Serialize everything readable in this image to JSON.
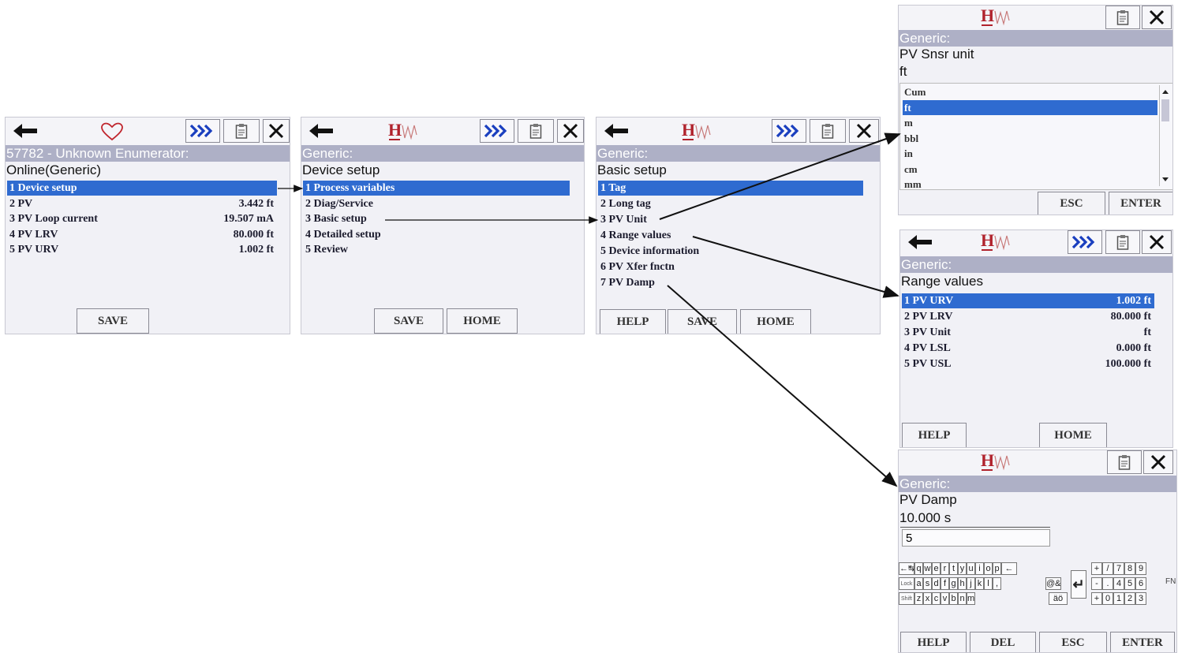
{
  "screens": {
    "online": {
      "header": "57782 - Unknown Enumerator:",
      "subheader": "Online(Generic)",
      "items": [
        {
          "label": "1 Device setup",
          "value": ""
        },
        {
          "label": "2 PV",
          "value": "3.442 ft"
        },
        {
          "label": "3 PV Loop current",
          "value": "19.507 mA"
        },
        {
          "label": "4 PV LRV",
          "value": "80.000 ft"
        },
        {
          "label": "5 PV URV",
          "value": "1.002 ft"
        }
      ],
      "selected_index": 0,
      "buttons": {
        "save": "SAVE"
      }
    },
    "device_setup": {
      "header": "Generic:",
      "subheader": "Device setup",
      "items": [
        {
          "label": "1 Process variables"
        },
        {
          "label": "2 Diag/Service"
        },
        {
          "label": "3 Basic setup"
        },
        {
          "label": "4 Detailed setup"
        },
        {
          "label": "5 Review"
        }
      ],
      "selected_index": 0,
      "buttons": {
        "save": "SAVE",
        "home": "HOME"
      }
    },
    "basic_setup": {
      "header": "Generic:",
      "subheader": "Basic setup",
      "items": [
        {
          "label": "1 Tag"
        },
        {
          "label": "2 Long tag"
        },
        {
          "label": "3 PV Unit"
        },
        {
          "label": "4 Range values"
        },
        {
          "label": "5 Device information"
        },
        {
          "label": "6 PV Xfer fnctn"
        },
        {
          "label": "7 PV Damp"
        }
      ],
      "selected_index": 0,
      "buttons": {
        "help": "HELP",
        "save": "SAVE",
        "home": "HOME"
      }
    },
    "pv_unit": {
      "header": "Generic:",
      "title": "PV Snsr unit",
      "current": "ft",
      "options": [
        "Cum",
        "ft",
        "m",
        "bbl",
        "in",
        "cm",
        "mm"
      ],
      "selected_option": "ft",
      "buttons": {
        "esc": "ESC",
        "enter": "ENTER"
      }
    },
    "range_values": {
      "header": "Generic:",
      "subheader": "Range values",
      "items": [
        {
          "label": "1 PV URV",
          "value": "1.002 ft"
        },
        {
          "label": "2 PV LRV",
          "value": "80.000 ft"
        },
        {
          "label": "3 PV Unit",
          "value": "ft"
        },
        {
          "label": "4 PV LSL",
          "value": "0.000 ft"
        },
        {
          "label": "5 PV USL",
          "value": "100.000 ft"
        }
      ],
      "selected_index": 0,
      "buttons": {
        "help": "HELP",
        "home": "HOME"
      }
    },
    "pv_damp": {
      "header": "Generic:",
      "title": "PV Damp",
      "current": "10.000 s",
      "input_value": "5",
      "keyboard": {
        "row1": [
          "←↹",
          "q",
          "w",
          "e",
          "r",
          "t",
          "y",
          "u",
          "i",
          "o",
          "p",
          "←"
        ],
        "row2": [
          "Lock",
          "a",
          "s",
          "d",
          "f",
          "g",
          "h",
          "j",
          "k",
          "l",
          ","
        ],
        "row3": [
          "Shift",
          "z",
          "x",
          "c",
          "v",
          "b",
          "n",
          "m"
        ],
        "special": {
          "enter_glyph": "↵",
          "at_key": "@&",
          "accent_key": "äö",
          "fn": "FN"
        },
        "num1": [
          "+",
          "/",
          "7",
          "8",
          "9"
        ],
        "num2": [
          "-",
          ".",
          "4",
          "5",
          "6"
        ],
        "num3": [
          "+",
          "0",
          "1",
          "2",
          "3"
        ]
      },
      "buttons": {
        "help": "HELP",
        "del": "DEL",
        "esc": "ESC",
        "enter": "ENTER"
      }
    }
  },
  "icons": {
    "back": "back-arrow-icon",
    "forward": "fast-forward-icon",
    "clipboard": "clipboard-icon",
    "close": "close-icon",
    "heart": "heart-icon",
    "logo": "hw-logo"
  },
  "logo_text": "H",
  "colors": {
    "header_bar": "#aeb0c6",
    "selection": "#2f6bd0",
    "logo": "#b0222c",
    "forward_icon": "#1a3fbf",
    "screen_bg": "#f1f1f6"
  }
}
